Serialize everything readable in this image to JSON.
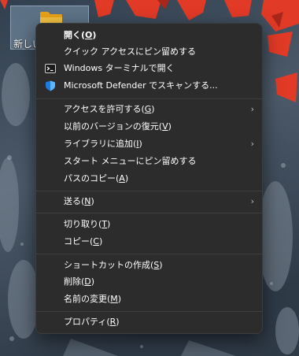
{
  "desktop": {
    "icon_label": "新しい",
    "colors": {
      "folder": "#f5c242",
      "menu_bg": "#2c2c2c",
      "text": "#ffffff",
      "leaves": "#e13a26"
    }
  },
  "menu": {
    "items": [
      {
        "text": "開く",
        "key": "O",
        "bold": true
      },
      {
        "text": "クイック アクセスにピン留めする",
        "key": ""
      },
      {
        "text": "Windows ターミナルで開く",
        "key": "",
        "icon": "terminal-icon"
      },
      {
        "text": "Microsoft Defender でスキャンする...",
        "key": "",
        "icon": "defender-shield-icon"
      },
      {
        "text": "アクセスを許可する",
        "key": "G",
        "submenu": true
      },
      {
        "text": "以前のバージョンの復元",
        "key": "V"
      },
      {
        "text": "ライブラリに追加",
        "key": "I",
        "submenu": true
      },
      {
        "text": "スタート メニューにピン留めする",
        "key": ""
      },
      {
        "text": "パスのコピー",
        "key": "A"
      },
      {
        "text": "送る",
        "key": "N",
        "submenu": true
      },
      {
        "text": "切り取り",
        "key": "T"
      },
      {
        "text": "コピー",
        "key": "C"
      },
      {
        "text": "ショートカットの作成",
        "key": "S"
      },
      {
        "text": "削除",
        "key": "D"
      },
      {
        "text": "名前の変更",
        "key": "M"
      },
      {
        "text": "プロパティ",
        "key": "R"
      }
    ]
  }
}
